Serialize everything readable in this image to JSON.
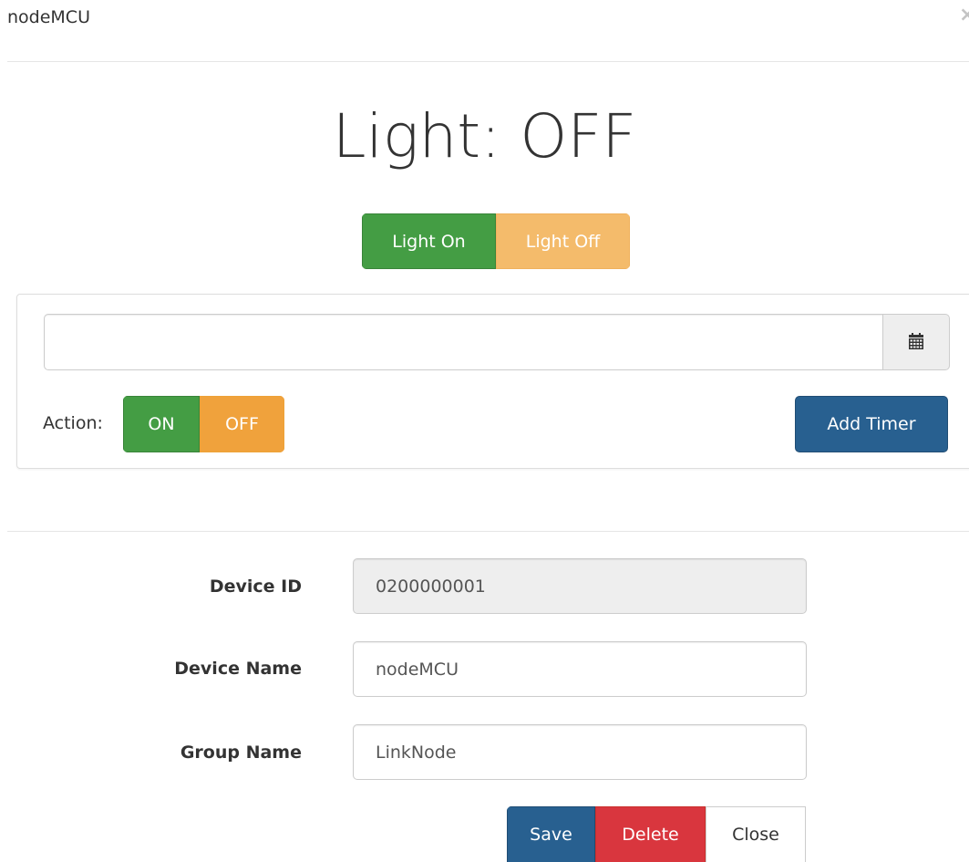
{
  "modal": {
    "title": "nodeMCU",
    "close_glyph": "×"
  },
  "status": {
    "title": "Light: OFF"
  },
  "light_controls": {
    "on_label": "Light On",
    "off_label": "Light Off"
  },
  "timer": {
    "datetime_value": "",
    "datetime_placeholder": "",
    "calendar_icon": "calendar-icon",
    "action_label": "Action:",
    "action_on_label": "ON",
    "action_off_label": "OFF",
    "add_timer_label": "Add Timer"
  },
  "form": {
    "device_id_label": "Device ID",
    "device_id_value": "0200000001",
    "device_name_label": "Device Name",
    "device_name_value": "nodeMCU",
    "group_name_label": "Group Name",
    "group_name_value": "LinkNode"
  },
  "footer": {
    "save_label": "Save",
    "delete_label": "Delete",
    "close_label": "Close"
  },
  "colors": {
    "success": "#449d44",
    "warning_light": "#f4bb6b",
    "warning": "#f0a23c",
    "primary": "#286090",
    "danger": "#d9363e"
  }
}
